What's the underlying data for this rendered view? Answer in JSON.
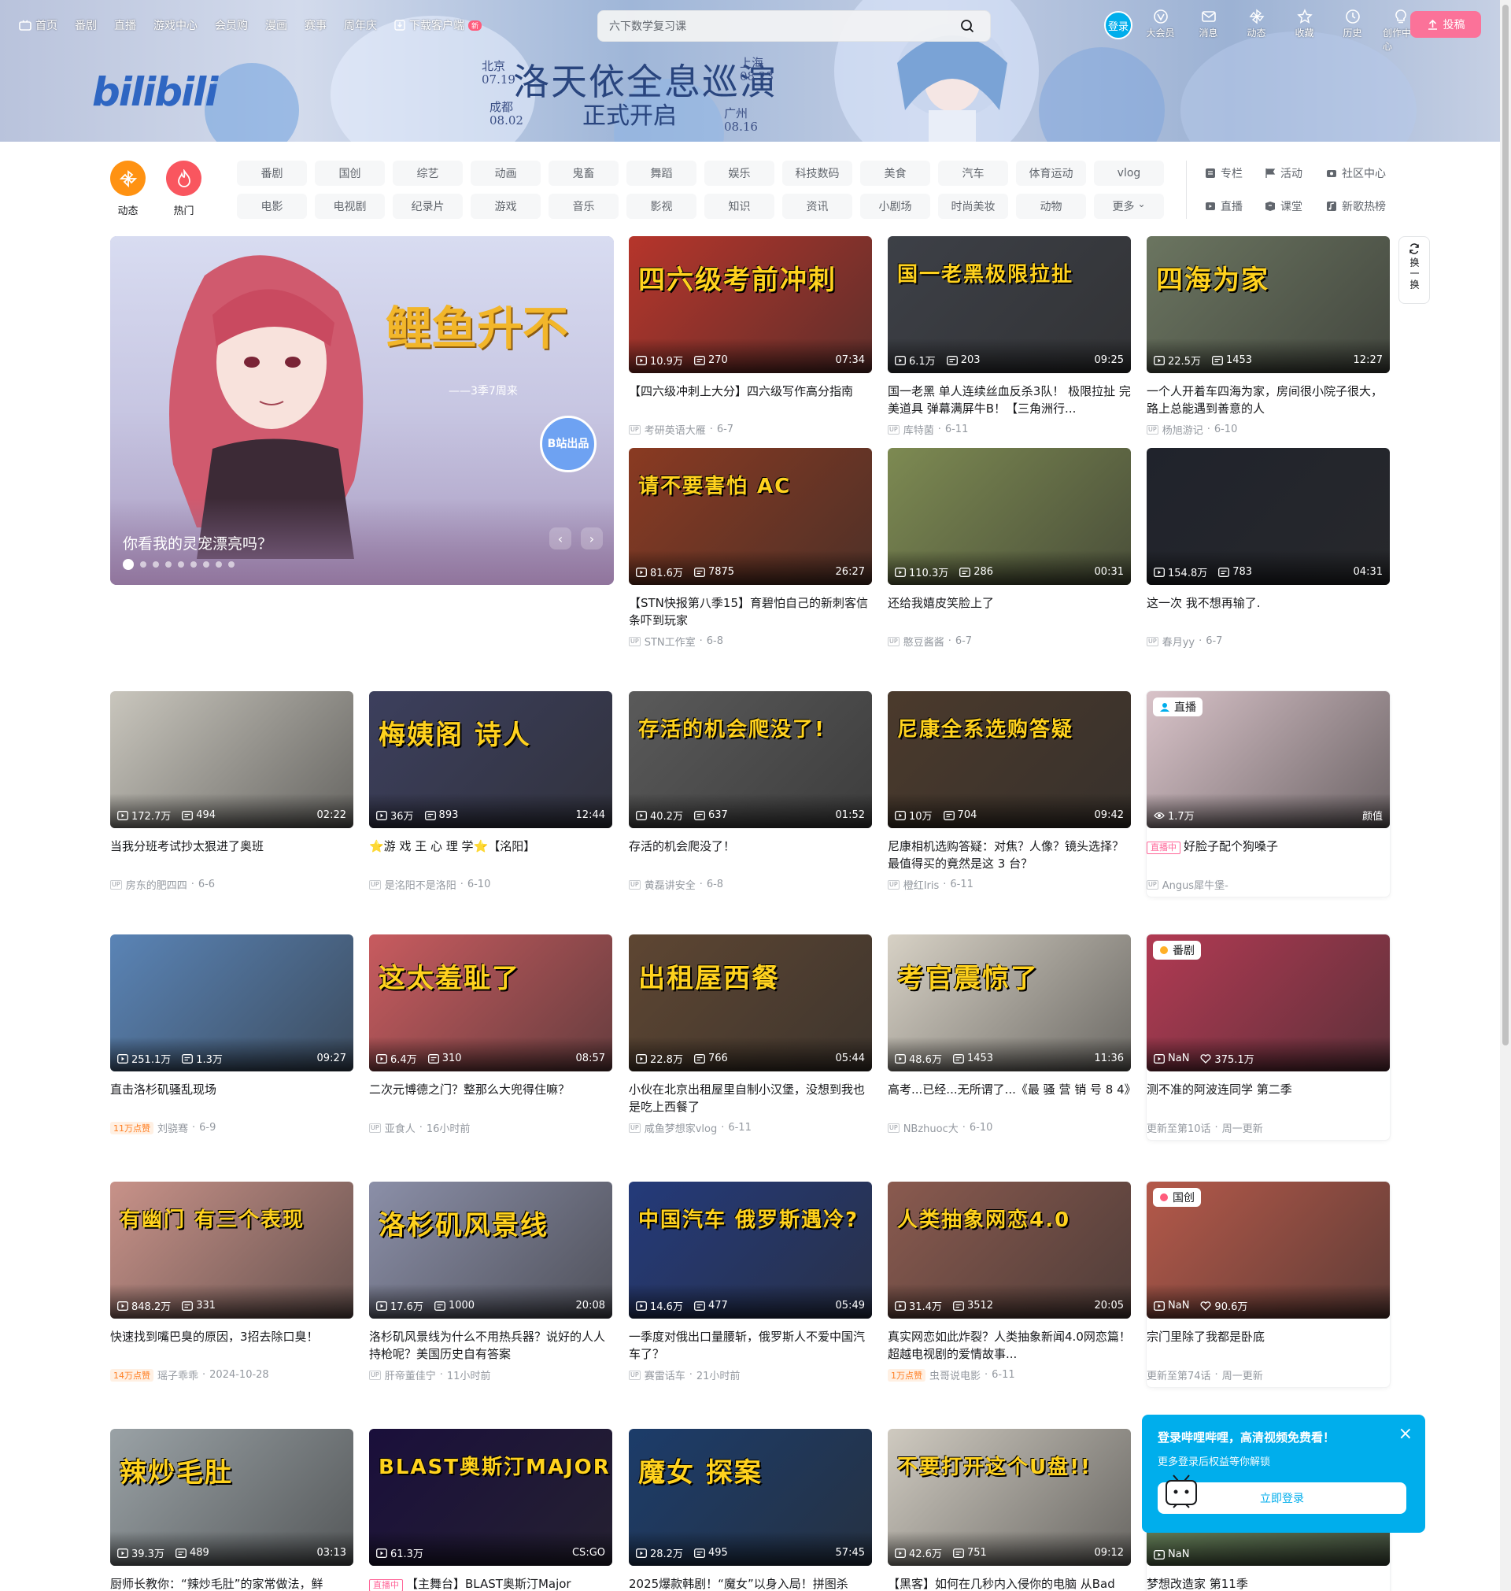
{
  "header": {
    "nav_left": [
      "首页",
      "番剧",
      "直播",
      "游戏中心",
      "会员购",
      "漫画",
      "赛事",
      "周年庆",
      "下载客户端"
    ],
    "new_badge": "新",
    "search_text": "六下数学复习课",
    "login": "登录",
    "nav_right": [
      "大会员",
      "消息",
      "动态",
      "收藏",
      "历史",
      "创作中心"
    ],
    "upload": "投稿",
    "logo": "bilibili"
  },
  "banner_text": {
    "title": "洛天依全息巡演",
    "subtitle": "正式开启",
    "cities": [
      "北京 07.19",
      "成都 08.02",
      "上海 08.23",
      "广州 08.16"
    ]
  },
  "channels": {
    "circles": [
      "动态",
      "热门"
    ],
    "categories": [
      "番剧",
      "国创",
      "综艺",
      "动画",
      "鬼畜",
      "舞蹈",
      "娱乐",
      "科技数码",
      "美食",
      "汽车",
      "体育运动",
      "vlog",
      "电影",
      "电视剧",
      "纪录片",
      "游戏",
      "音乐",
      "影视",
      "知识",
      "资讯",
      "小剧场",
      "时尚美妆",
      "动物",
      "更多"
    ],
    "links": [
      "专栏",
      "活动",
      "社区中心",
      "直播",
      "课堂",
      "新歌热榜"
    ]
  },
  "carousel": {
    "caption": "你看我的灵宠漂亮吗？",
    "overlay_text": "鲤鱼升不",
    "overlay_sub": "——3季7周来",
    "badge": "B站出品",
    "dots": 9
  },
  "refresh": "换一换",
  "cards": [
    {
      "views": "10.9万",
      "danmaku": "270",
      "dur": "07:34",
      "title": "【四六级冲刺上大分】四六级写作高分指南",
      "author": "考研英语大雁",
      "date": "6-7",
      "ov": "四六级考前冲刺",
      "bg": "#b6352b"
    },
    {
      "views": "6.1万",
      "danmaku": "203",
      "dur": "09:25",
      "title": "国一老黑 单人连续丝血反杀3队！ 极限拉扯 完美道具 弹幕满屏牛B！【三角洲行...",
      "author": "库特菌",
      "date": "6-11",
      "ov": "国一老黑极限拉扯",
      "bg": "#3d4047"
    },
    {
      "views": "22.5万",
      "danmaku": "1453",
      "dur": "12:27",
      "title": "一个人开着车四海为家，房间很小院子很大，路上总能遇到善意的人",
      "author": "杨旭游记",
      "date": "6-10",
      "ov": "四海为家",
      "bg": "#6b7560"
    },
    {
      "views": "81.6万",
      "danmaku": "7875",
      "dur": "26:27",
      "title": "【STN快报第八季15】育碧怕自己的新刺客信条吓到玩家",
      "author": "STN工作室",
      "date": "6-8",
      "ov": "请不要害怕 AC",
      "bg": "#8a3a22"
    },
    {
      "views": "110.3万",
      "danmaku": "286",
      "dur": "00:31",
      "title": "还给我嬉皮笑脸上了",
      "author": "憨豆酱酱",
      "date": "6-7",
      "ov": "",
      "bg": "#7d8a52"
    },
    {
      "views": "154.8万",
      "danmaku": "783",
      "dur": "04:31",
      "title": "这一次 我不想再输了.",
      "author": "春月yy",
      "date": "6-7",
      "ov": "",
      "bg": "#20232c"
    },
    {
      "views": "172.7万",
      "danmaku": "494",
      "dur": "02:22",
      "title": "当我分班考试抄太狠进了奥班",
      "author": "房东的肥四四",
      "date": "6-6",
      "ov": "",
      "bg": "#c9c6bd"
    },
    {
      "views": "36万",
      "danmaku": "893",
      "dur": "12:44",
      "title": "⭐游 戏 王 心 理 学⭐【洺阳】",
      "author": "是洺阳不是洛阳",
      "date": "6-10",
      "ov": "梅姨阁 诗人",
      "bg": "#3c3f5d"
    },
    {
      "views": "40.2万",
      "danmaku": "637",
      "dur": "01:52",
      "title": "存活的机会爬没了！",
      "author": "黄磊讲安全",
      "date": "6-8",
      "ov": "存活的机会爬没了!",
      "bg": "#5a5a5a"
    },
    {
      "views": "10万",
      "danmaku": "704",
      "dur": "09:42",
      "title": "尼康相机选购答疑：对焦？人像？镜头选择？最值得买的竟然是这 3 台？",
      "author": "橙红Iris",
      "date": "6-11",
      "ov": "尼康全系选购答疑",
      "bg": "#4b3a2c"
    },
    {
      "live": true,
      "live_tag": "直播",
      "views": "1.7万",
      "extra": "颜值",
      "live_badge": "直播中",
      "title": "好脸子配个狗嗓子",
      "author": "Angus犀牛堡-",
      "date": "",
      "bg": "#d9c3c9"
    },
    {
      "views": "251.1万",
      "danmaku": "1.3万",
      "dur": "09:27",
      "title": "直击洛杉矶骚乱现场",
      "author": "刘骁骞",
      "date": "6-9",
      "likes": "11万点赞",
      "ov": "",
      "bg": "#5a84b6"
    },
    {
      "views": "6.4万",
      "danmaku": "310",
      "dur": "08:57",
      "title": "二次元博德之门？整那么大兜得住嘛？",
      "author": "亚食人",
      "date": "16小时前",
      "ov": "这太羞耻了",
      "bg": "#c85b5f"
    },
    {
      "views": "22.8万",
      "danmaku": "766",
      "dur": "05:44",
      "title": "小伙在北京出租屋里自制小汉堡，没想到我也是吃上西餐了",
      "author": "咸鱼梦想家vlog",
      "date": "6-11",
      "ov": "出租屋西餐",
      "bg": "#5e4632"
    },
    {
      "views": "48.6万",
      "danmaku": "1453",
      "dur": "11:36",
      "title": "高考...已经...无所谓了...《最 骚 营 销 号 8 4》",
      "author": "NBzhuoc大",
      "date": "6-10",
      "ov": "考官震惊了",
      "bg": "#d7d1c5"
    },
    {
      "bangumi": true,
      "corner": "番剧",
      "views": "NaN",
      "fav": "375.1万",
      "title": "测不准的阿波连同学 第二季",
      "update": "更新至第10话",
      "week": "周一更新",
      "bg": "#b23a53"
    },
    {
      "views": "848.2万",
      "danmaku": "331",
      "dur": "",
      "title": "快速找到嘴巴臭的原因，3招去除口臭！",
      "author": "瑶子乖乖",
      "date": "2024-10-28",
      "likes": "14万点赞",
      "ov": "有幽门 有三个表现",
      "bg": "#c89289"
    },
    {
      "views": "17.6万",
      "danmaku": "1000",
      "dur": "20:08",
      "title": "洛杉矶风景线为什么不用热兵器？说好的人人持枪呢？美国历史自有答案",
      "author": "肝帝董佳宁",
      "date": "11小时前",
      "ov": "洛杉矶风景线",
      "bg": "#8b8fa8"
    },
    {
      "views": "14.6万",
      "danmaku": "477",
      "dur": "05:49",
      "title": "一季度对俄出口量腰斩，俄罗斯人不爱中国汽车了？",
      "author": "赛雷话车",
      "date": "21小时前",
      "ov": "中国汽车 俄罗斯遇冷?",
      "bg": "#243a7a"
    },
    {
      "views": "31.4万",
      "danmaku": "3512",
      "dur": "20:05",
      "title": "真实网恋如此炸裂？人类抽象新闻4.0网恋篇！超越电视剧的爱情故事...",
      "author": "虫哥说电影",
      "date": "6-11",
      "likes": "1万点赞",
      "ov": "人类抽象网恋4.0",
      "bg": "#8a5a4f"
    },
    {
      "bangumi": true,
      "corner": "国创",
      "views": "NaN",
      "fav": "90.6万",
      "title": "宗门里除了我都是卧底",
      "update": "更新至第74话",
      "week": "周一更新",
      "bg": "#b5594a"
    },
    {
      "views": "39.3万",
      "danmaku": "489",
      "dur": "03:13",
      "title": "厨师长教你：“辣炒毛肚”的家常做法，鲜",
      "author": "",
      "date": "",
      "ov": "辣炒毛肚",
      "bg": "#9aa2a6"
    },
    {
      "views": "61.3万",
      "danmaku": "",
      "dur": "CS:GO",
      "title": "【主舞台】BLAST奥斯汀Major",
      "author": "",
      "date": "",
      "ov": "BLAST奥斯汀MAJOR",
      "bg": "#1a0f3b",
      "live_prefix": "直播中"
    },
    {
      "views": "28.2万",
      "danmaku": "495",
      "dur": "57:45",
      "title": "2025爆款韩剧！“魔女”以身入局！拼图杀",
      "author": "",
      "date": "",
      "ov": "魔女 探案",
      "bg": "#1c3c6a"
    },
    {
      "views": "42.6万",
      "danmaku": "751",
      "dur": "09:12",
      "title": "【黑客】如何在几秒内入侵你的电脑 从Bad",
      "author": "",
      "date": "",
      "ov": "不要打开这个U盘!!",
      "bg": "#cfcac0"
    },
    {
      "bangumi": true,
      "views": "NaN",
      "title": "梦想改造家 第11季",
      "bg": "#6d8c5e"
    }
  ],
  "popup": {
    "title": "登录哔哩哔哩，高清视频免费看！",
    "desc": "更多登录后权益等你解锁",
    "button": "立即登录"
  },
  "colors": {
    "brand_pink": "#fb7299",
    "brand_blue": "#00aeec",
    "orange": "#ff7f24"
  }
}
